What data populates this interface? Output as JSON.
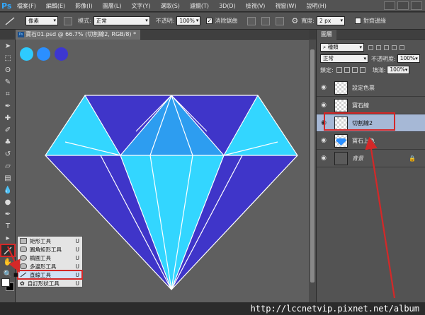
{
  "app": {
    "logo": "Ps"
  },
  "menu": [
    "檔案(F)",
    "編輯(E)",
    "影像(I)",
    "圖層(L)",
    "文字(Y)",
    "選取(S)",
    "濾鏡(T)",
    "3D(D)",
    "檢視(V)",
    "視窗(W)",
    "說明(H)"
  ],
  "options": {
    "mode_select": "像素",
    "mode_label": "模式:",
    "mode_value": "正常",
    "opacity_label": "不透明:",
    "opacity_value": "100%",
    "antialias_label": "消除鋸齒",
    "weight_label": "寬度:",
    "weight_value": "2 px",
    "align_edges_label": "對齊邊緣"
  },
  "document": {
    "tab_title": "寶石01.psd @ 66.7% (切割線2, RGB/8) *"
  },
  "swatches": [
    "#2ecbff",
    "#2b8fff",
    "#3d37d0"
  ],
  "diamond": {
    "light": "#33d6ff",
    "mid": "#2d9df0",
    "dark": "#3f35c9",
    "line": "#ffffff"
  },
  "flyout": {
    "items": [
      {
        "label": "矩形工具",
        "key": "U"
      },
      {
        "label": "圓角矩形工具",
        "key": "U"
      },
      {
        "label": "橢圓工具",
        "key": "U"
      },
      {
        "label": "多邊形工具",
        "key": "U"
      },
      {
        "label": "直線工具",
        "key": "U"
      },
      {
        "label": "自訂形狀工具",
        "key": "U"
      }
    ]
  },
  "layers_panel": {
    "tab": "圖層",
    "filter": "種類",
    "blend_mode": "正常",
    "opacity_label": "不透明度:",
    "opacity_value": "100%",
    "lock_label": "鎖定:",
    "fill_label": "填滿:",
    "fill_value": "100%",
    "layers": [
      {
        "name": "設定色票",
        "selected": false
      },
      {
        "name": "寶石線",
        "selected": false
      },
      {
        "name": "切割線2",
        "selected": true
      },
      {
        "name": "寶石上色",
        "selected": false
      },
      {
        "name": "背景",
        "selected": false,
        "locked": true
      }
    ]
  },
  "watermark": "http://lccnetvip.pixnet.net/album"
}
